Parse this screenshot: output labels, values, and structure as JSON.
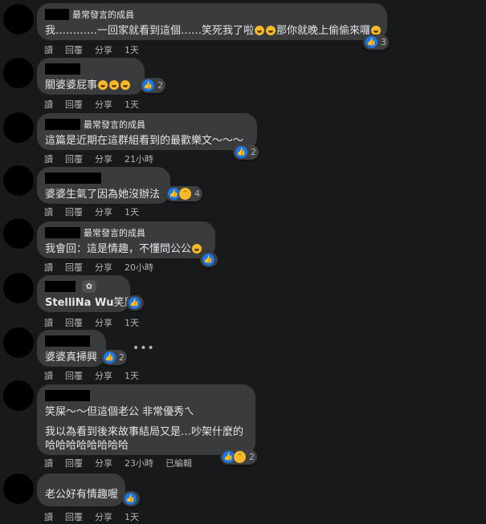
{
  "actions": {
    "read": "讀",
    "reply": "回覆",
    "share": "分享"
  },
  "comments": [
    {
      "tag": "最常發言的成員",
      "text": "我…………一回家就看到這個……笑死我了啦",
      "text2": "那你就晚上偷偷來囉",
      "time": "1天",
      "reactions": "3"
    },
    {
      "tag": "",
      "text": "關婆婆屁事",
      "time": "1天",
      "reactions": "2"
    },
    {
      "tag": "最常發言的成員",
      "text": "這篇是近期在這群組看到的最歡樂文～～～",
      "time": "21小時",
      "reactions": "2"
    },
    {
      "tag": "",
      "text": "婆婆生氣了因為她沒辦法",
      "time": "1天",
      "reactions": "4"
    },
    {
      "tag": "最常發言的成員",
      "text": "我會回：這是情趣，不懂問公公",
      "time": "20小時",
      "reactions": ""
    },
    {
      "tag": "",
      "mention": "StelliNa Wu",
      "text": "笑屎",
      "time": "1天",
      "reactions": ""
    },
    {
      "tag": "",
      "text": "婆婆真掃興",
      "time": "1天",
      "reactions": "2",
      "more": "•••"
    },
    {
      "tag": "",
      "text": "笑屎～～但這個老公 非常優秀ㄟ",
      "text2": "我以為看到後來故事結局又是…吵架什麼的哈哈哈哈哈哈哈哈",
      "time": "23小時",
      "edited": "已編輯",
      "reactions": "2"
    },
    {
      "tag": "",
      "text": "老公好有情趣喔",
      "time": "1天",
      "reactions": ""
    }
  ],
  "colors": {
    "background": "#18191a",
    "bubble": "#3a3b3c",
    "like": "#1877f2",
    "haha": "#f7b928"
  },
  "icons": {
    "like": "like-icon",
    "haha": "haha-icon",
    "squint": "squint-laugh-icon",
    "leaf": "rising-member-icon",
    "more": "more-horizontal-icon"
  }
}
